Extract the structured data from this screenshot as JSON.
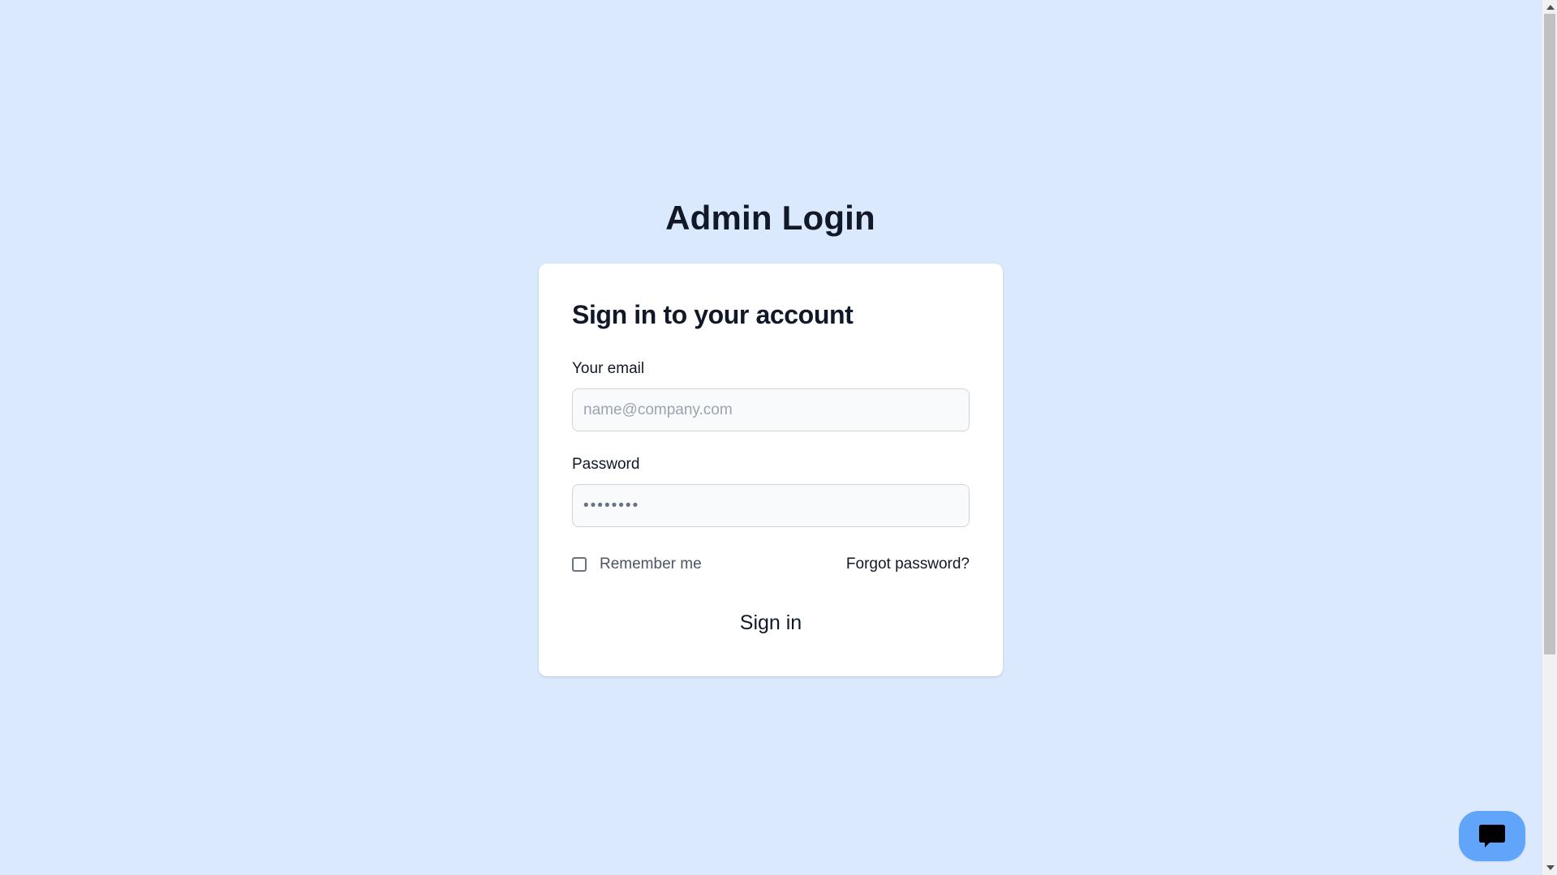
{
  "page": {
    "title": "Admin Login",
    "background_color": "#dbe9fe"
  },
  "login_card": {
    "heading": "Sign in to your account",
    "email": {
      "label": "Your email",
      "placeholder": "name@company.com",
      "value": ""
    },
    "password": {
      "label": "Password",
      "placeholder": "••••••••",
      "value": ""
    },
    "remember_me": {
      "label": "Remember me",
      "checked": false
    },
    "forgot_password_label": "Forgot password?",
    "submit_label": "Sign in"
  },
  "chat_widget": {
    "icon": "chat-bubble-icon",
    "color": "#60a5fa"
  }
}
